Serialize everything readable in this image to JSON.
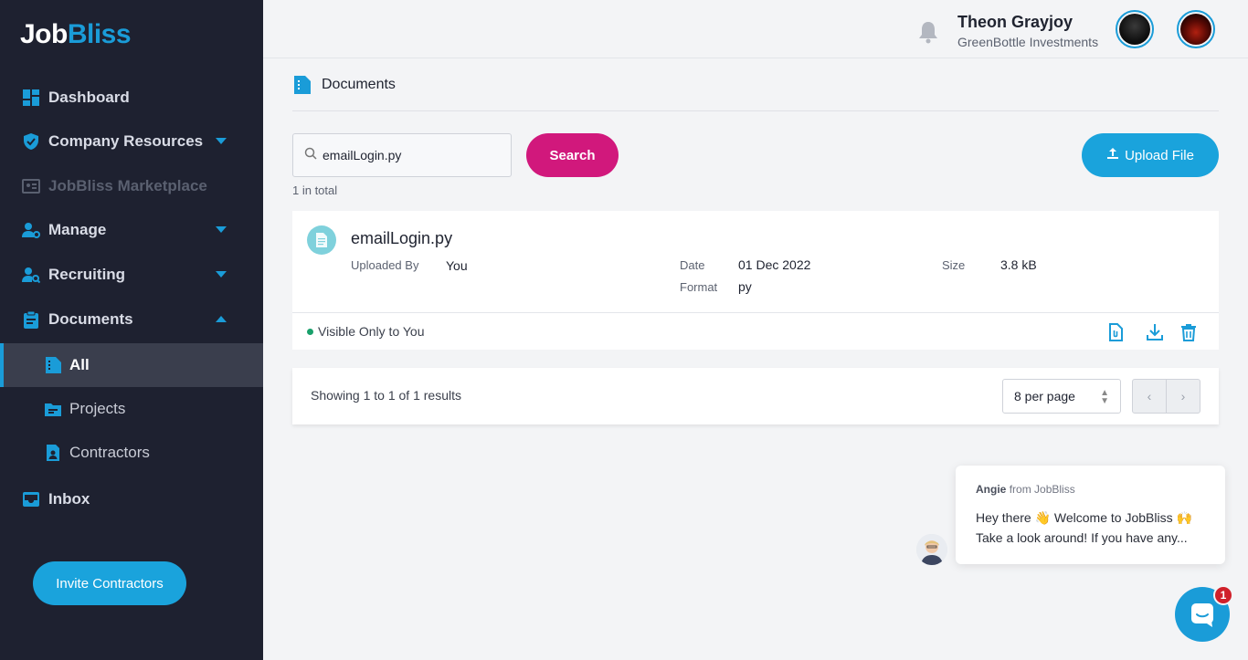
{
  "brand": {
    "logo_text_1": "Job",
    "logo_text_2": "Bliss"
  },
  "colors": {
    "accent": "#1a9cd8",
    "primary_button": "#d1187c",
    "sidebar": "#1e2130"
  },
  "sidebar": {
    "items": [
      {
        "label": "Dashboard",
        "icon": "dashboard-icon"
      },
      {
        "label": "Company Resources",
        "icon": "shield-icon"
      },
      {
        "label": "JobBliss Marketplace",
        "icon": "marketplace-icon"
      },
      {
        "label": "Manage",
        "icon": "people-settings-icon"
      },
      {
        "label": "Recruiting",
        "icon": "person-search-icon"
      },
      {
        "label": "Documents",
        "icon": "clipboard-icon"
      },
      {
        "label": "Inbox",
        "icon": "inbox-icon"
      }
    ],
    "documents_sub": [
      {
        "label": "All",
        "icon": "document-icon"
      },
      {
        "label": "Projects",
        "icon": "folder-icon"
      },
      {
        "label": "Contractors",
        "icon": "contractor-file-icon"
      }
    ],
    "invite_label": "Invite Contractors"
  },
  "header": {
    "user_name": "Theon Grayjoy",
    "company": "GreenBottle Investments"
  },
  "page": {
    "breadcrumb": "Documents",
    "search_value": "emailLogin.py",
    "search_button": "Search",
    "upload_button": "Upload File",
    "total_text": "1 in total"
  },
  "document": {
    "name": "emailLogin.py",
    "uploaded_by_label": "Uploaded By",
    "uploaded_by": "You",
    "date_label": "Date",
    "date": "01 Dec 2022",
    "format_label": "Format",
    "format": "py",
    "size_label": "Size",
    "size": "3.8 kB",
    "visibility": "Visible Only to You"
  },
  "pagination": {
    "summary": "Showing 1 to 1 of 1 results",
    "per_page": "8 per page",
    "prev": "‹",
    "next": "›"
  },
  "chat": {
    "sender": "Angie",
    "from_text": "from JobBliss",
    "line1": "Hey there 👋 Welcome to JobBliss 🙌",
    "line2": "Take a look around! If you have any...",
    "badge": "1"
  }
}
